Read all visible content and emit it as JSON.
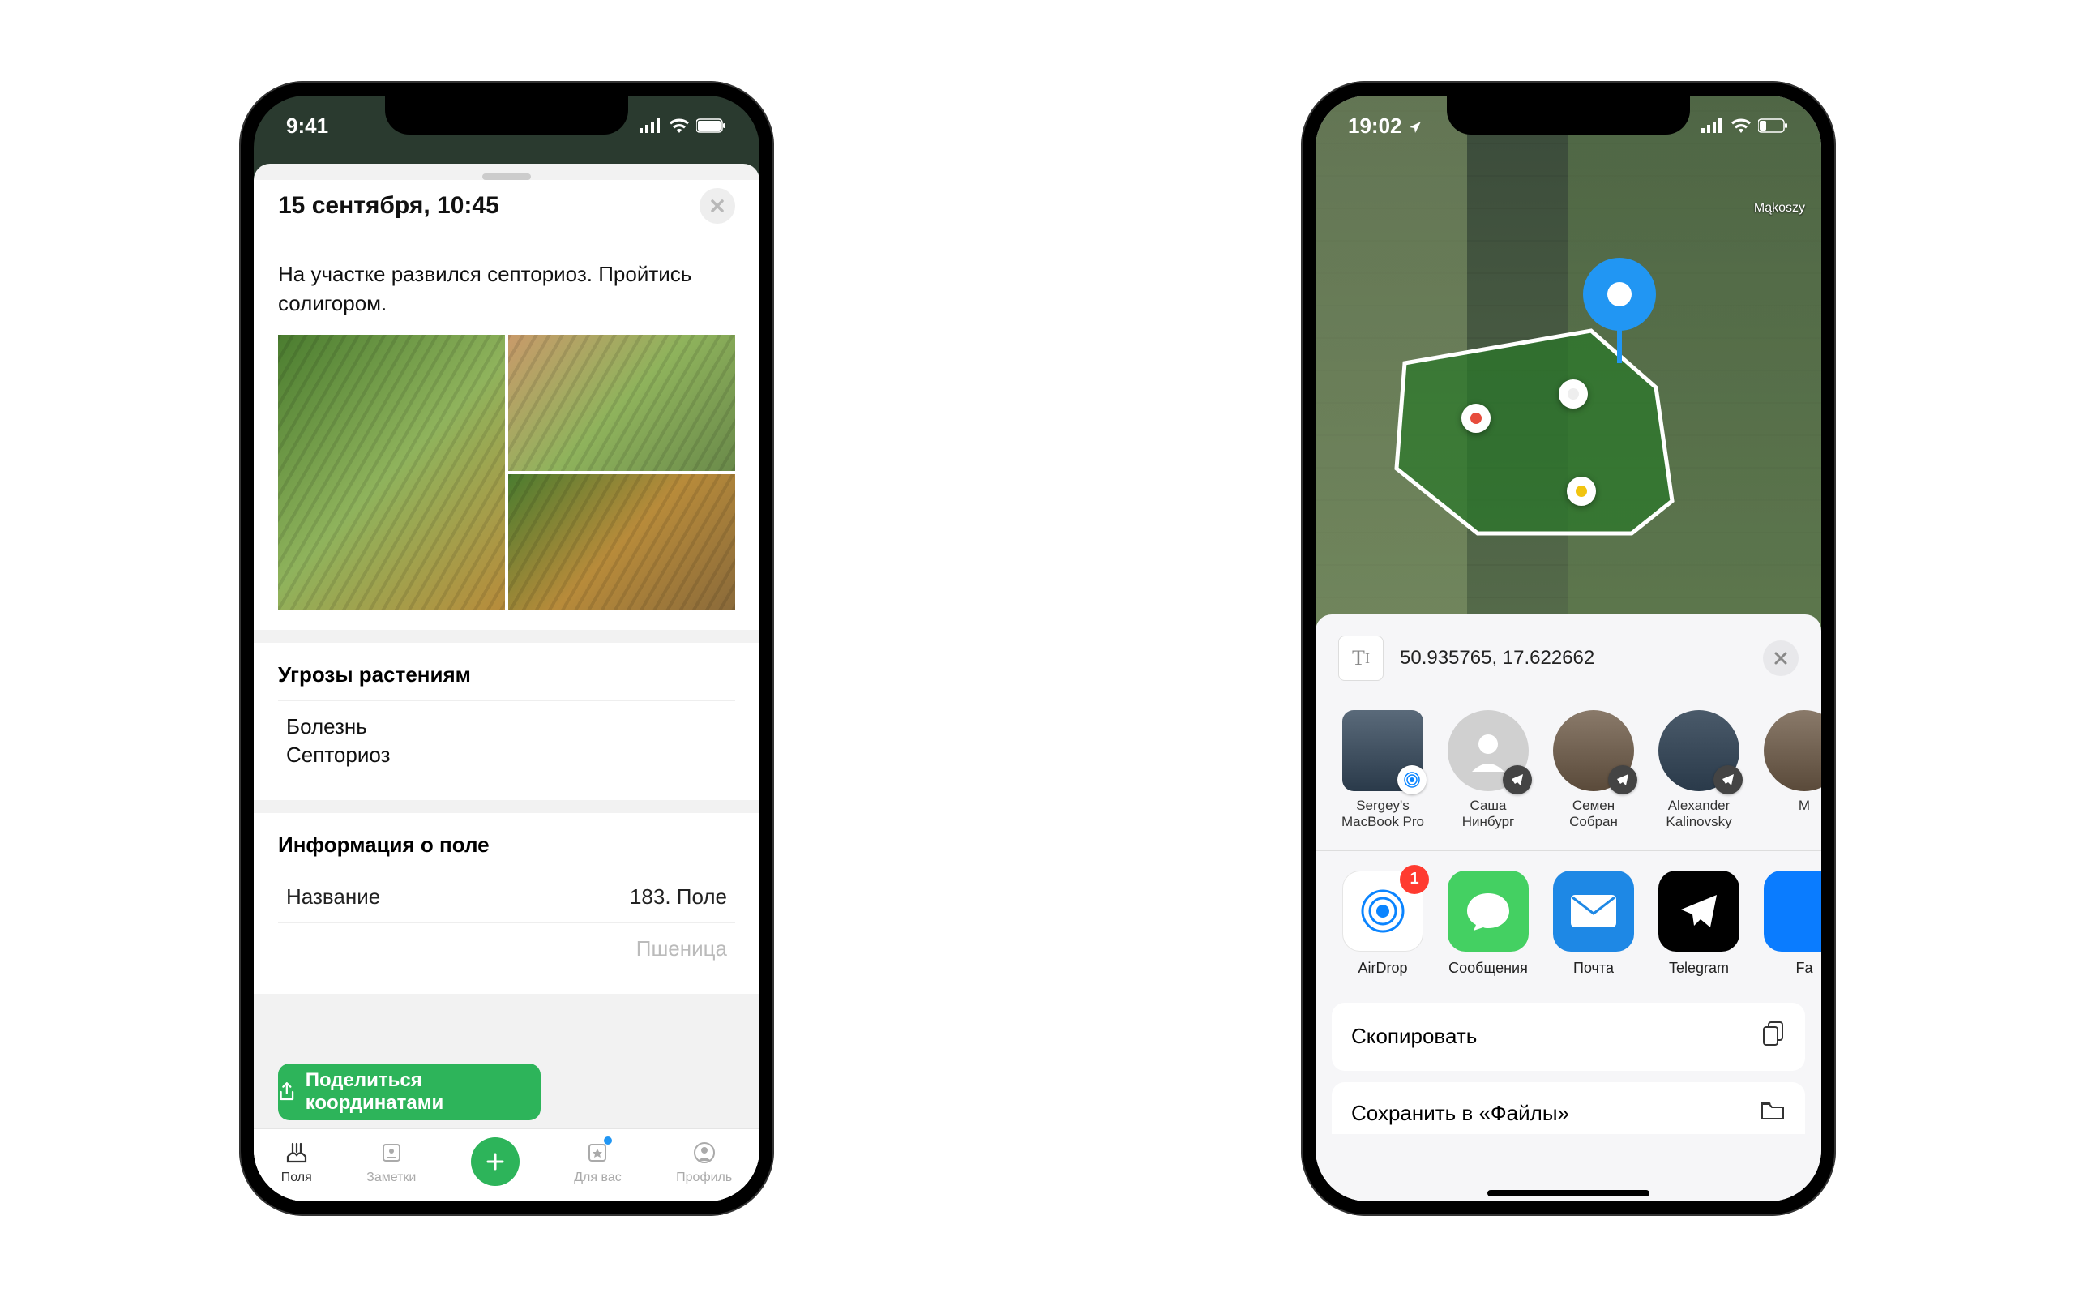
{
  "phone1": {
    "status_time": "9:41",
    "sheet_title": "15 сентября, 10:45",
    "note_text": "На участке развился септориоз. Пройтись солигором.",
    "threats_title": "Угрозы растениям",
    "threat_type": "Болезнь",
    "threat_name": "Септориоз",
    "field_info_title": "Информация о поле",
    "field_name_label": "Название",
    "field_name_value": "183. Поле",
    "field_crop_value": "Пшеница",
    "share_btn": "Поделиться координатами",
    "tabs": {
      "fields": "Поля",
      "notes": "Заметки",
      "foryou": "Для вас",
      "profile": "Профиль"
    }
  },
  "phone2": {
    "status_time": "19:02",
    "map_label": "Mąkoszy",
    "coordinates": "50.935765, 17.622662",
    "contacts": [
      {
        "name": "Sergey's MacBook Pro"
      },
      {
        "name": "Саша Нинбург"
      },
      {
        "name": "Семен Собран"
      },
      {
        "name": "Alexander Kalinovsky"
      },
      {
        "name": "M"
      }
    ],
    "apps": {
      "airdrop": "AirDrop",
      "airdrop_badge": "1",
      "messages": "Сообщения",
      "mail": "Почта",
      "telegram": "Telegram",
      "other": "Fa"
    },
    "actions": {
      "copy": "Скопировать",
      "save_files": "Сохранить в «Файлы»"
    }
  }
}
